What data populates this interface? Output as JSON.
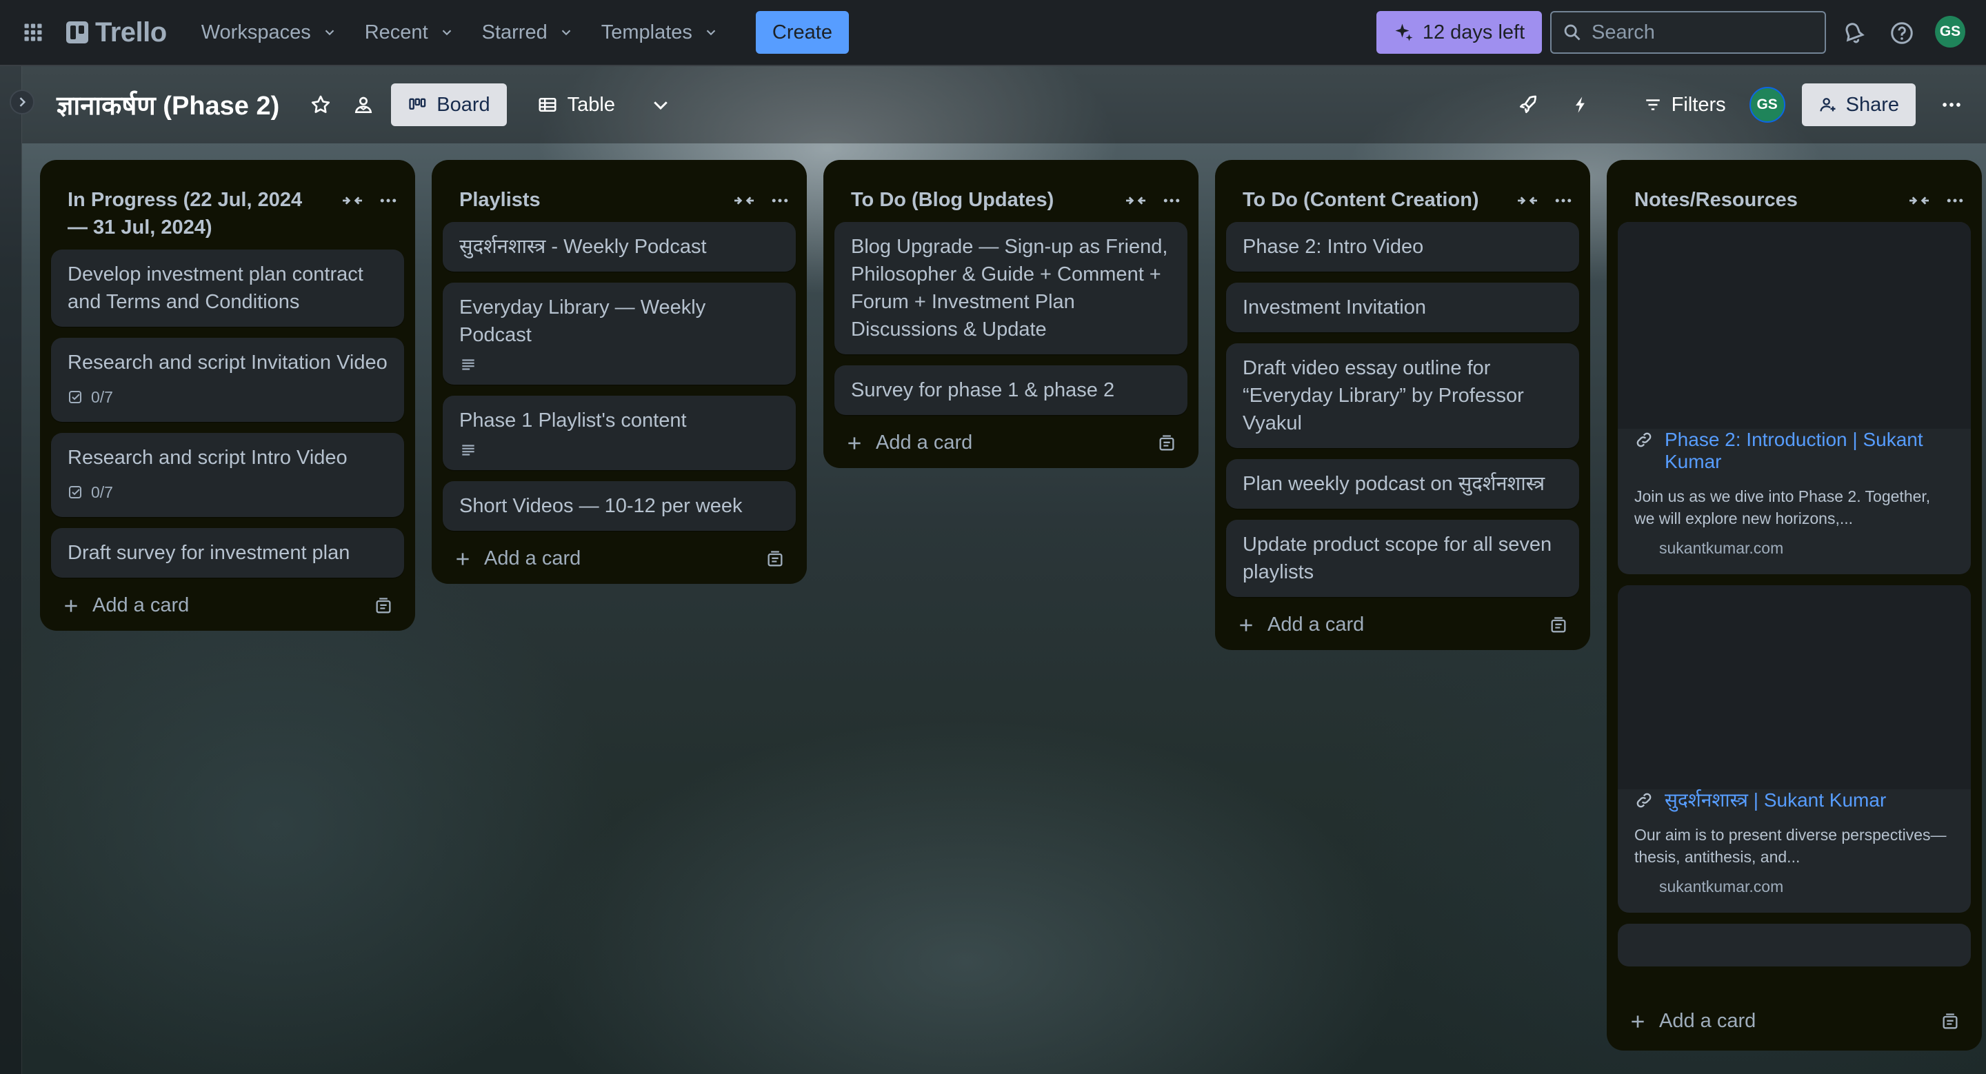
{
  "nav": {
    "brand": "Trello",
    "menus": [
      "Workspaces",
      "Recent",
      "Starred",
      "Templates"
    ],
    "create_label": "Create",
    "trial_label": "12 days left",
    "search_placeholder": "Search",
    "avatar_initials": "GS"
  },
  "board": {
    "title": "ज्ञानाकर्षण (Phase 2)",
    "views": [
      "Board",
      "Table"
    ],
    "filters_label": "Filters",
    "share_label": "Share",
    "avatar_initials": "GS"
  },
  "lists": [
    {
      "title": "In Progress (22 Jul, 2024 — 31 Jul, 2024)",
      "cards": [
        {
          "text": "Develop investment plan contract and Terms and Conditions"
        },
        {
          "text": "Research and script Invitation Video",
          "checklist": "0/7"
        },
        {
          "text": "Research and script Intro Video",
          "checklist": "0/7"
        },
        {
          "text": "Draft survey for investment plan"
        }
      ],
      "add_label": "Add a card"
    },
    {
      "title": "Playlists",
      "cards": [
        {
          "text": "सुदर्शनशास्त्र - Weekly Podcast"
        },
        {
          "text": "Everyday Library — Weekly Podcast",
          "has_description": true
        },
        {
          "text": "Phase 1 Playlist's content",
          "has_description": true
        },
        {
          "text": "Short Videos — 10-12 per week"
        }
      ],
      "add_label": "Add a card"
    },
    {
      "title": "To Do (Blog Updates)",
      "cards": [
        {
          "text": "Blog Upgrade — Sign-up as Friend, Philosopher & Guide + Comment + Forum + Investment Plan Discussions & Update"
        },
        {
          "text": "Survey for phase 1 & phase 2"
        }
      ],
      "add_label": "Add a card"
    },
    {
      "title": "To Do (Content Creation)",
      "cards": [
        {
          "text": "Phase 2: Intro Video"
        },
        {
          "text": "Investment Invitation"
        },
        {
          "text": "Draft video essay outline for “Everyday Library” by Professor Vyakul"
        },
        {
          "text": "Plan weekly podcast on सुदर्शनशास्त्र"
        },
        {
          "text": "Update product scope for all seven playlists"
        }
      ],
      "add_label": "Add a card"
    },
    {
      "title": "Notes/Resources",
      "link_cards": [
        {
          "title": "Phase 2: Introduction | Sukant Kumar",
          "description": "Join us as we dive into Phase 2. Together, we will explore new horizons,...",
          "domain": "sukantkumar.com"
        },
        {
          "title": "सुदर्शनशास्त्र | Sukant Kumar",
          "description": "Our aim is to present diverse perspectives—thesis, antithesis, and...",
          "domain": "sukantkumar.com"
        }
      ],
      "add_label": "Add a card"
    }
  ],
  "colors": {
    "accent_blue": "#579dff",
    "trial_purple": "#9f8fef",
    "list_bg": "#101204",
    "card_bg": "#22272b",
    "avatar_green": "#1f845a"
  }
}
